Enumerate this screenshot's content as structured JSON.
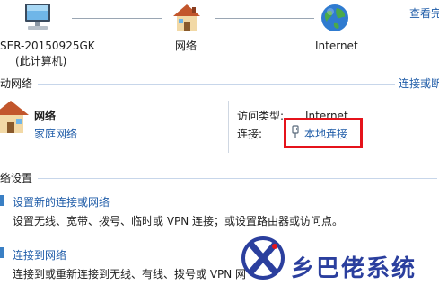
{
  "topmap": {
    "see_full_map": "查看完",
    "computer_name": "SER-20150925GK",
    "computer_note": "(此计算机)",
    "network_label": "网络",
    "internet_label": "Internet"
  },
  "active_networks": {
    "section_title": "动网络",
    "connect_disconnect": "连接或断",
    "network_name": "网络",
    "network_type": "家庭网络",
    "access_type_label": "访问类型:",
    "access_type_value": "Internet",
    "connection_label": "连接:",
    "connection_value": "本地连接"
  },
  "settings": {
    "section_title": "络设置",
    "items": [
      {
        "title": "设置新的连接或网络",
        "desc": "设置无线、宽带、拨号、临时或 VPN 连接；或设置路由器或访问点。"
      },
      {
        "title": "连接到网络",
        "desc": "连接到或重新连接到无线、有线、拨号或 VPN 网"
      }
    ]
  },
  "watermark": {
    "text": "乡巴佬系统",
    "logo_letter": "X"
  },
  "colors": {
    "link": "#1f5ca8",
    "highlight": "#e5131b",
    "watermark": "#2b3f9e"
  }
}
